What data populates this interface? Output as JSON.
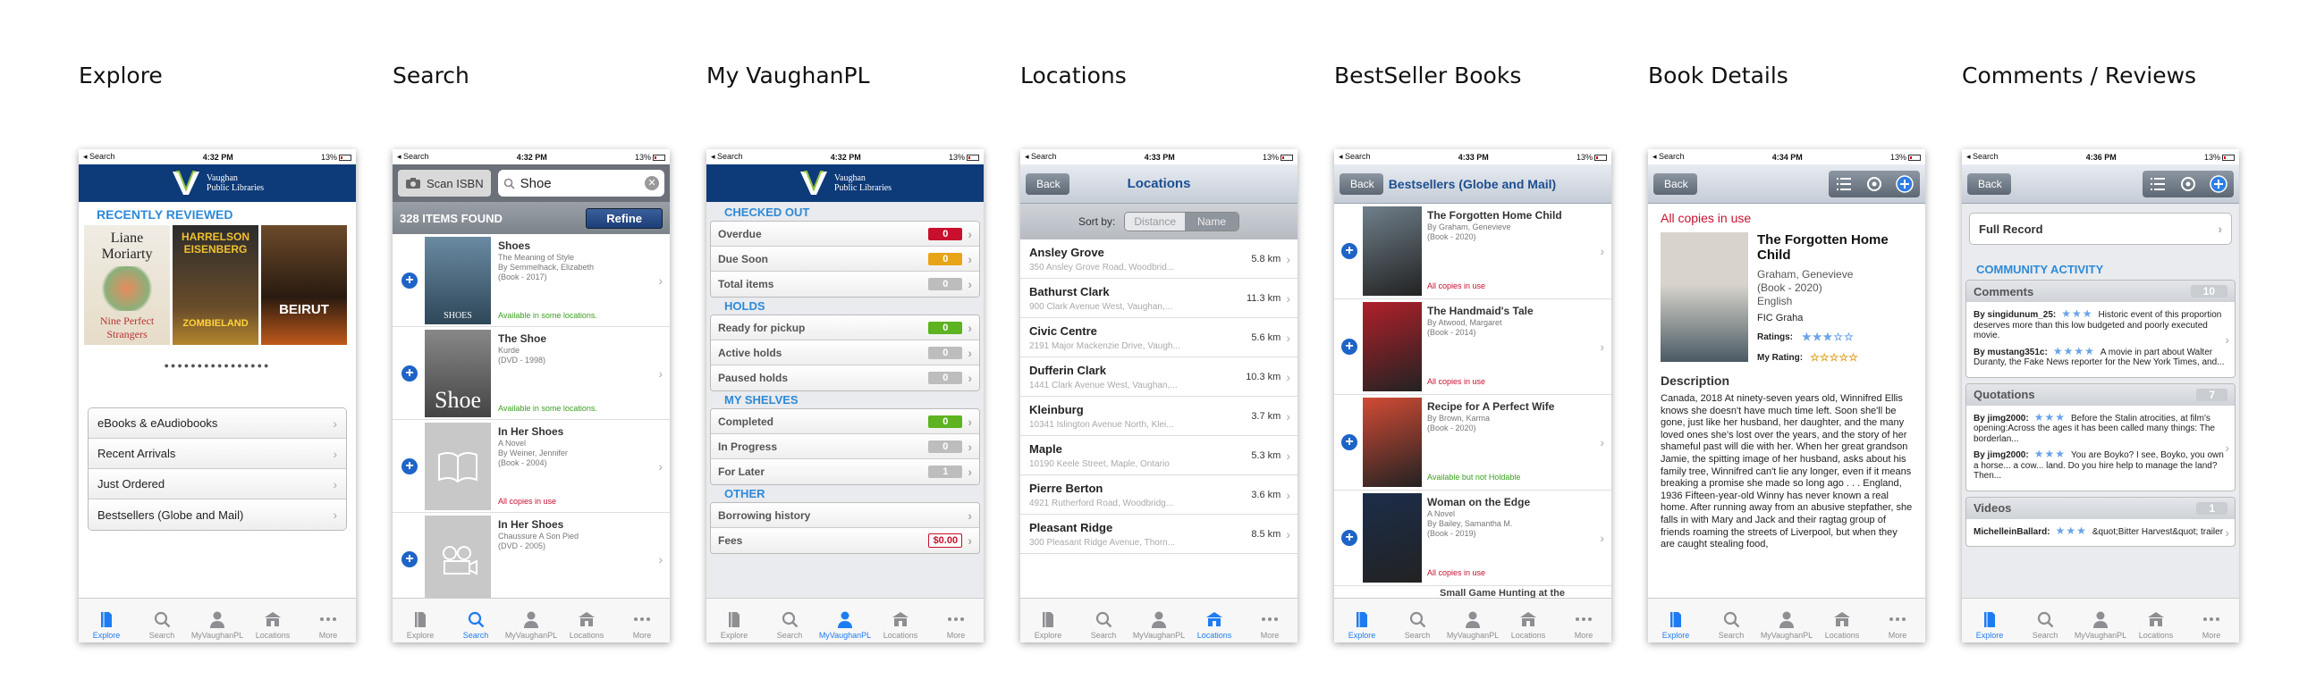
{
  "status": {
    "left": "◂ Search",
    "time1": "4:32 PM",
    "time2": "4:33 PM",
    "time3": "4:34 PM",
    "time4": "4:36 PM",
    "battery": "13%"
  },
  "screens": [
    {
      "label": "Explore"
    },
    {
      "label": "Search"
    },
    {
      "label": "My VaughanPL"
    },
    {
      "label": "Locations"
    },
    {
      "label": "BestSeller Books"
    },
    {
      "label": "Book Details"
    },
    {
      "label": "Comments / Reviews"
    }
  ],
  "logo": {
    "line1": "Vaughan",
    "line2": "Public Libraries"
  },
  "tabs": [
    {
      "label": "Explore",
      "icon": "book-icon"
    },
    {
      "label": "Search",
      "icon": "search-icon"
    },
    {
      "label": "MyVaughanPL",
      "icon": "person-icon"
    },
    {
      "label": "Locations",
      "icon": "building-icon"
    },
    {
      "label": "More",
      "icon": "more-icon"
    }
  ],
  "explore": {
    "recent": "RECENTLY REVIEWED",
    "books": [
      {
        "top": "Liane",
        "mid": "Moriarty",
        "bottom": "Nine Perfect Strangers"
      },
      {
        "top": "HARRELSON",
        "mid": "EISENBERG",
        "bottom": "ZOMBIELAND"
      },
      {
        "top": "",
        "mid": "",
        "bottom": "BEIRUT"
      }
    ],
    "menu": [
      "eBooks & eAudiobooks",
      "Recent Arrivals",
      "Just Ordered",
      "Bestsellers (Globe and Mail)"
    ]
  },
  "search": {
    "scan": "Scan ISBN",
    "query": "Shoe",
    "found": "328 ITEMS FOUND",
    "refine": "Refine",
    "items": [
      {
        "title": "Shoes",
        "l1": "The Meaning of Style",
        "l2": "By Semmelhack, Elizabeth",
        "l3": "(Book - 2017)",
        "status": "Available in some locations.",
        "cover": "SHOES"
      },
      {
        "title": "The Shoe",
        "l1": "Kurde",
        "l2": "(DVD - 1998)",
        "l3": "",
        "status": "Available in some locations.",
        "cover": "Shoe"
      },
      {
        "title": "In Her Shoes",
        "l1": "A Novel",
        "l2": "By Weiner, Jennifer",
        "l3": "(Book - 2004)",
        "status": "All copies in use",
        "cover": ""
      },
      {
        "title": "In Her Shoes",
        "l1": "Chaussure A Son Pied",
        "l2": "(DVD - 2005)",
        "l3": "",
        "status": "",
        "cover": ""
      }
    ]
  },
  "my": {
    "checked": "CHECKED OUT",
    "holds": "HOLDS",
    "shelves": "MY SHELVES",
    "other": "OTHER",
    "co": [
      {
        "label": "Overdue",
        "count": "0",
        "color": "#c8102e"
      },
      {
        "label": "Due Soon",
        "count": "0",
        "color": "#e8a417"
      },
      {
        "label": "Total items",
        "count": "0",
        "color": "#bdbdbd"
      }
    ],
    "ho": [
      {
        "label": "Ready for pickup",
        "count": "0",
        "color": "#5db320"
      },
      {
        "label": "Active holds",
        "count": "0",
        "color": "#bdbdbd"
      },
      {
        "label": "Paused holds",
        "count": "0",
        "color": "#bdbdbd"
      }
    ],
    "sh": [
      {
        "label": "Completed",
        "count": "0",
        "color": "#5db320"
      },
      {
        "label": "In Progress",
        "count": "0",
        "color": "#bdbdbd"
      },
      {
        "label": "For Later",
        "count": "1",
        "color": "#bdbdbd"
      }
    ],
    "ot": [
      {
        "label": "Borrowing history",
        "count": ""
      },
      {
        "label": "Fees",
        "count": "$0.00"
      }
    ]
  },
  "loc": {
    "back": "Back",
    "title": "Locations",
    "sortby": "Sort by:",
    "distance": "Distance",
    "name": "Name",
    "items": [
      {
        "name": "Ansley Grove",
        "addr": "350 Ansley Grove Road, Woodbrid...",
        "dist": "5.8 km"
      },
      {
        "name": "Bathurst Clark",
        "addr": "900 Clark Avenue West, Vaughan,...",
        "dist": "11.3 km"
      },
      {
        "name": "Civic Centre",
        "addr": "2191 Major Mackenzie Drive, Vaugh...",
        "dist": "5.6 km"
      },
      {
        "name": "Dufferin Clark",
        "addr": "1441 Clark Avenue West, Vaughan,...",
        "dist": "10.3 km"
      },
      {
        "name": "Kleinburg",
        "addr": "10341 Islington Avenue North, Klei...",
        "dist": "3.7 km"
      },
      {
        "name": "Maple",
        "addr": "10190 Keele Street, Maple, Ontario",
        "dist": "5.3 km"
      },
      {
        "name": "Pierre Berton",
        "addr": "4921 Rutherford Road, Woodbridg...",
        "dist": "3.6 km"
      },
      {
        "name": "Pleasant Ridge",
        "addr": "300 Pleasant Ridge Avenue, Thorn...",
        "dist": "8.5 km"
      }
    ]
  },
  "best": {
    "back": "Back",
    "title": "Bestsellers (Globe and Mail)",
    "items": [
      {
        "title": "The Forgotten Home Child",
        "l1": "By Graham, Genevieve",
        "l2": "(Book - 2020)",
        "status": "All copies in use",
        "cover": "#6f7f8a"
      },
      {
        "title": "The Handmaid's Tale",
        "l1": "By Atwood, Margaret",
        "l2": "(Book - 2014)",
        "status": "All copies in use",
        "cover": "#b0202a"
      },
      {
        "title": "Recipe for A Perfect Wife",
        "l1": "By Brown, Karma",
        "l2": "(Book - 2020)",
        "status": "Available but not Holdable",
        "cover": "#d24b35"
      },
      {
        "title": "Woman on the Edge",
        "l1": "A Novel",
        "l2": "By Bailey, Samantha M.",
        "l3": "(Book - 2019)",
        "status": "All copies in use",
        "cover": "#1c2d4a"
      }
    ],
    "partial": "Small Game Hunting at the"
  },
  "detail": {
    "back": "Back",
    "avail": "All copies in use",
    "title": "The Forgotten Home Child",
    "author": "Graham, Genevieve",
    "pub": "(Book - 2020)",
    "lang": "English",
    "call": "FIC Graha",
    "ratings": "Ratings:",
    "myrating": "My Rating:",
    "desc": "Description",
    "body": "Canada, 2018 At ninety-seven years old, Winnifred Ellis knows she doesn't have much time left. Soon she'll be gone, just like her husband, her daughter, and the many loved ones she's lost over the years, and the story of her shameful past will die with her. When her great grandson Jamie, the spitting image of her husband, asks about his family tree, Winnifred can't lie any longer, even if it means breaking a promise she made so long ago . . . England, 1936 Fifteen-year-old Winny has never known a real home. After running away from an abusive stepfather, she falls in with Mary and Jack and their ragtag group of friends roaming the streets of Liverpool, but when they are caught stealing food,"
  },
  "comments": {
    "back": "Back",
    "full": "Full Record",
    "activity": "COMMUNITY ACTIVITY",
    "comments": {
      "label": "Comments",
      "count": "10",
      "e1": "By singidunum_25:",
      "t1": "Historic event of this proportion deserves more than this low budgeted and poorly executed movie.",
      "e2": "By mustang351c:",
      "t2": "A movie in part about Walter Duranty, the Fake News reporter for the New York Times, and..."
    },
    "quotes": {
      "label": "Quotations",
      "count": "7",
      "e1": "By jimg2000:",
      "t1": "Before the Stalin atrocities, at film's opening:Across the ages it has been called many things: The borderlan...",
      "e2": "By jimg2000:",
      "t2": "You are Boyko? I see, Boyko, you own a horse... a cow... land. Do you hire help to manage the land? Then..."
    },
    "videos": {
      "label": "Videos",
      "count": "1",
      "e1": "MichelleinBallard:",
      "t1": "&quot;Bitter Harvest&quot; trailer"
    }
  }
}
